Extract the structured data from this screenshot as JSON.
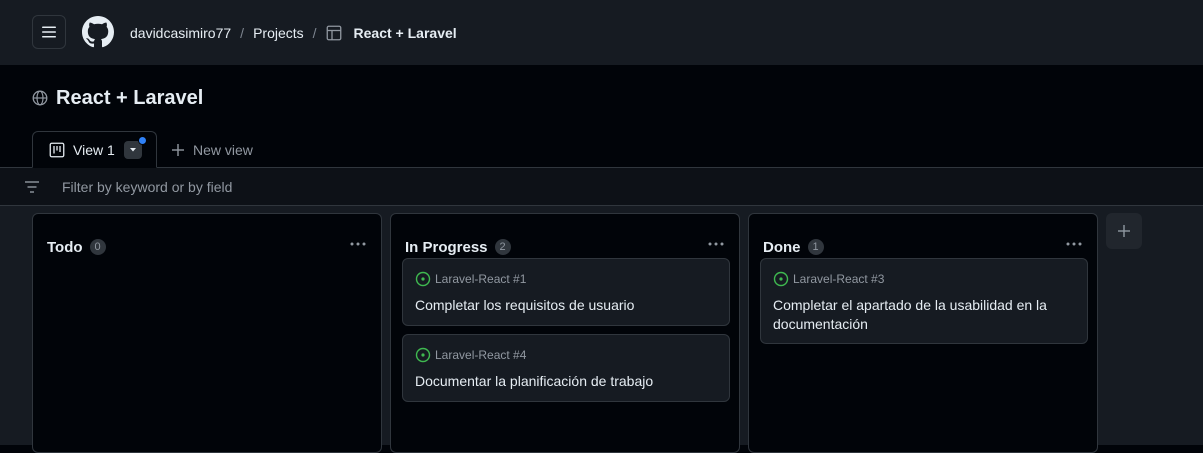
{
  "header": {
    "owner": "davidcasimiro77",
    "separator": "/",
    "projects_link": "Projects",
    "project_name": "React + Laravel"
  },
  "project": {
    "title": "React + Laravel"
  },
  "tabs": {
    "active_label": "View 1",
    "new_view_label": "New view"
  },
  "filter": {
    "placeholder": "Filter by keyword or by field"
  },
  "board": {
    "columns": [
      {
        "name": "Todo",
        "count": "0",
        "cards": []
      },
      {
        "name": "In Progress",
        "count": "2",
        "cards": [
          {
            "ref": "Laravel-React #1",
            "title": "Completar los requisitos de usuario"
          },
          {
            "ref": "Laravel-React #4",
            "title": "Documentar la planificación de trabajo"
          }
        ]
      },
      {
        "name": "Done",
        "count": "1",
        "cards": [
          {
            "ref": "Laravel-React #3",
            "title": "Completar el apartado de la usabilidad en la documentación"
          }
        ]
      }
    ]
  },
  "colors": {
    "header_bg": "#161b22",
    "page_bg": "#010409",
    "border": "#30363d",
    "accent_dot": "#2f81f7",
    "open_issue_green": "#3fb950",
    "muted_text": "#9198a1"
  },
  "icons": {
    "menu": "hamburger-icon",
    "logo": "github-logo-icon",
    "project": "table-icon",
    "visibility": "globe-icon",
    "view": "board-icon",
    "add": "plus-icon",
    "filter": "filter-icon",
    "column_menu": "kebab-icon",
    "issue": "issue-open-icon"
  }
}
